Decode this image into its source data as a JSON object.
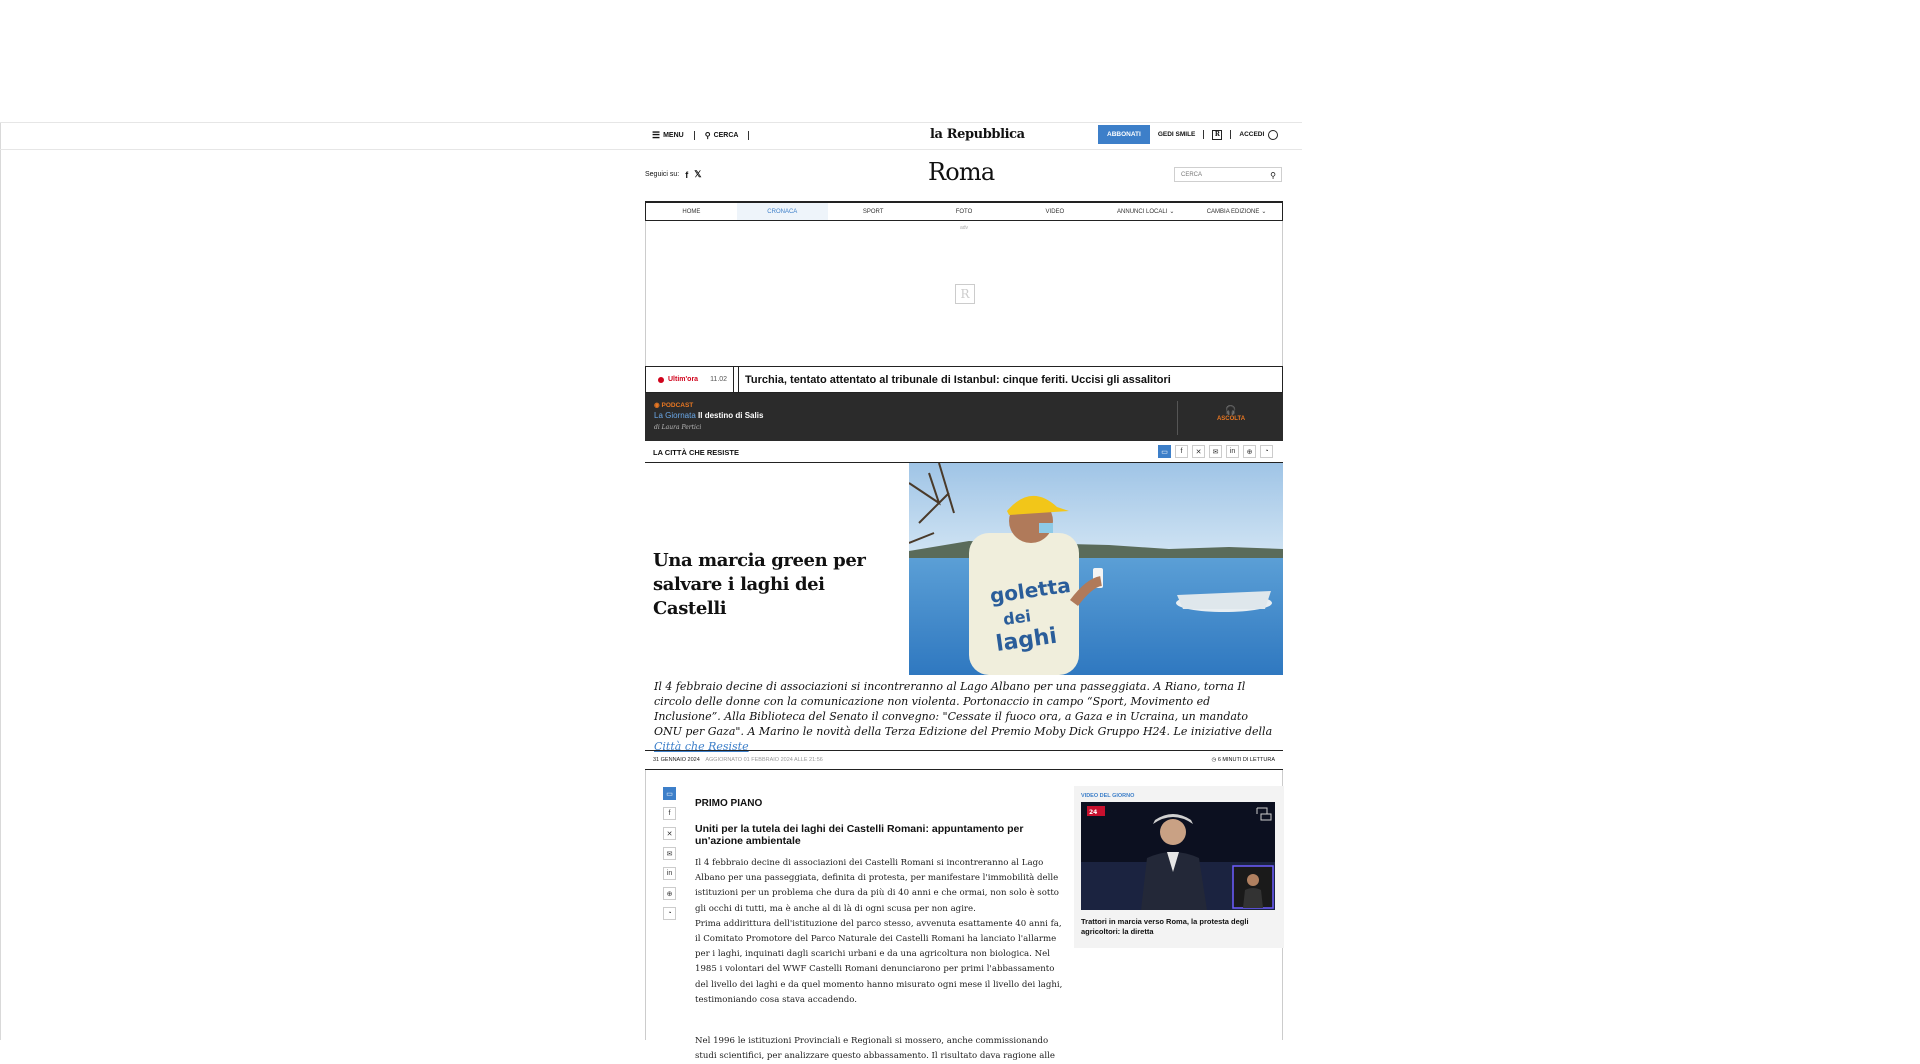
{
  "topbar": {
    "menu": "MENU",
    "search": "CERCA",
    "brand": "la Repubblica",
    "subscribe": "ABBONATI",
    "gedi": "GEDI SMILE",
    "r_logo": "R",
    "login": "ACCEDI"
  },
  "city": {
    "follow": "Seguici su:",
    "title": "Roma",
    "search_placeholder": "CERCA"
  },
  "nav": [
    "HOME",
    "CRONACA",
    "SPORT",
    "FOTO",
    "VIDEO",
    "ANNUNCI LOCALI",
    "CAMBIA EDIZIONE"
  ],
  "ad": {
    "label": "adv",
    "logo": "R"
  },
  "breaking": {
    "label": "Ultim'ora",
    "time": "11.02",
    "headline": "Turchia, tentato attentato al tribunale di Istanbul: cinque feriti. Uccisi gli assalitori"
  },
  "podcast": {
    "kicker": "PODCAST",
    "show": "La Giornata",
    "episode": "Il destino di Salis",
    "author": "di Laura Pertici",
    "listen": "ASCOLTA"
  },
  "share": {
    "section": "LA CITTÀ CHE RESISTE"
  },
  "hero": {
    "headline": "Una marcia green per salvare i laghi dei Castelli"
  },
  "summary": {
    "text": "Il 4 febbraio decine di associazioni si incontreranno al Lago Albano per una passeggiata. A Riano, torna Il circolo delle donne con la comunicazione non violenta. Portonaccio in campo “Sport, Movimento ed Inclusione”. Alla Biblioteca del Senato il convegno: \"Cessate il fuoco ora, a Gaza e in Ucraina, un mandato ONU per Gaza\". A Marino le novità della Terza Edizione del Premio Moby Dick Gruppo H24. Le iniziative della",
    "link": "Città che Resiste"
  },
  "meta": {
    "date": "31 GENNAIO 2024",
    "updated": "AGGIORNATO 01 FEBBRAIO 2024 ALLE 21:56",
    "read": "6 MINUTI DI LETTURA"
  },
  "article": {
    "kicker": "PRIMO PIANO",
    "title": "Uniti per la tutela dei laghi dei Castelli Romani: appuntamento per un'azione ambientale",
    "p1": "Il 4 febbraio decine di associazioni dei Castelli Romani si incontreranno al Lago Albano per una passeggiata, definita di protesta, per manifestare l'immobilità delle istituzioni per un problema che dura da più di 40 anni e che ormai, non solo è sotto gli occhi di tutti, ma è anche al di là di ogni scusa per non agire.",
    "p2": "Prima addirittura dell'istituzione del parco stesso, avvenuta esattamente 40 anni fa, il Comitato Promotore del Parco Naturale dei Castelli Romani ha lanciato l'allarme per i laghi, inquinati dagli scarichi urbani e da una agricoltura non biologica. Nel 1985 i volontari del WWF Castelli Romani denunciarono per primi l'abbassamento del livello dei laghi e da quel momento hanno misurato ogni mese il livello dei laghi, testimoniando cosa stava accadendo.",
    "p3": "Nel 1996 le istituzioni Provinciali e Regionali si mossero, anche commissionando studi scientifici, per analizzare questo abbassamento. Il risultato dava ragione alle"
  },
  "video": {
    "label": "VIDEO DEL GIORNO",
    "caption": "Trattori in marcia verso Roma, la protesta degli agricoltori: la diretta",
    "badge": "SKY TG24"
  }
}
